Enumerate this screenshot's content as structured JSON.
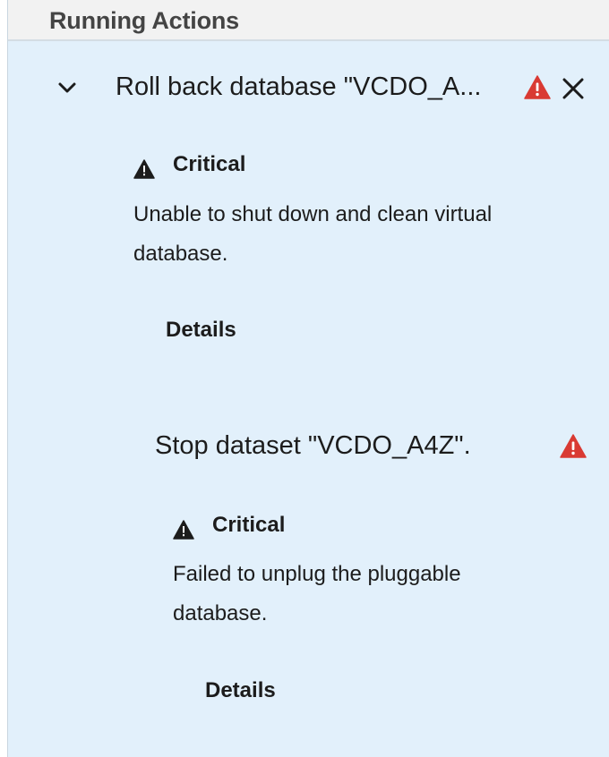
{
  "panel": {
    "title": "Running Actions"
  },
  "actions": [
    {
      "title": "Roll back database \"VCDO_A...",
      "status_icon": "warning-red-triangle",
      "alert": {
        "severity": "Critical",
        "message_line1": " Unable to shut down and clean virtual",
        "message_line2": "database.",
        "details_label": "Details"
      }
    },
    {
      "title": "Stop dataset \"VCDO_A4Z\".",
      "status_icon": "warning-red-triangle",
      "alert": {
        "severity": "Critical",
        "message_line1": " Failed to unplug the pluggable",
        "message_line2": "database.",
        "details_label": "Details"
      }
    }
  ],
  "colors": {
    "panel_bg": "#e2f0fb",
    "header_bg": "#f2f2f2",
    "warning_red": "#d93a33",
    "text": "#1c1c1c"
  }
}
